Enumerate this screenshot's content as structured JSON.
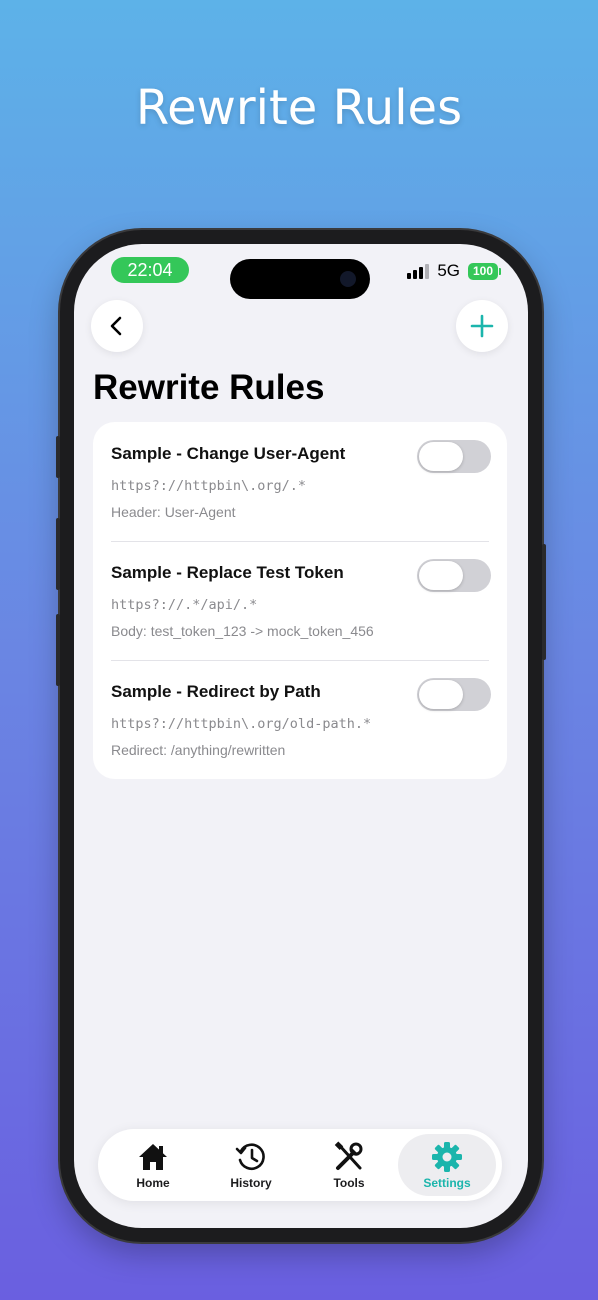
{
  "promo": {
    "title": "Rewrite Rules"
  },
  "status_bar": {
    "time": "22:04",
    "network": "5G",
    "battery": "100"
  },
  "nav": {
    "back_icon": "chevron-left-icon",
    "add_icon": "plus-icon"
  },
  "page": {
    "title": "Rewrite Rules"
  },
  "rules": [
    {
      "name": "Sample - Change User-Agent",
      "pattern": "https?://httpbin\\.org/.*",
      "detail": "Header: User-Agent",
      "enabled": false
    },
    {
      "name": "Sample - Replace Test Token",
      "pattern": "https?://.*/api/.*",
      "detail": "Body: test_token_123 -> mock_token_456",
      "enabled": false
    },
    {
      "name": "Sample - Redirect by Path",
      "pattern": "https?://httpbin\\.org/old-path.*",
      "detail": "Redirect: /anything/rewritten",
      "enabled": false
    }
  ],
  "tabs": [
    {
      "label": "Home",
      "icon": "house-icon",
      "active": false
    },
    {
      "label": "History",
      "icon": "clock-history-icon",
      "active": false
    },
    {
      "label": "Tools",
      "icon": "wrench-screwdriver-icon",
      "active": false
    },
    {
      "label": "Settings",
      "icon": "gear-icon",
      "active": true
    }
  ],
  "colors": {
    "accent": "#1bb5ac",
    "status_green": "#34c759",
    "toggle_off": "#d1d1d6"
  }
}
